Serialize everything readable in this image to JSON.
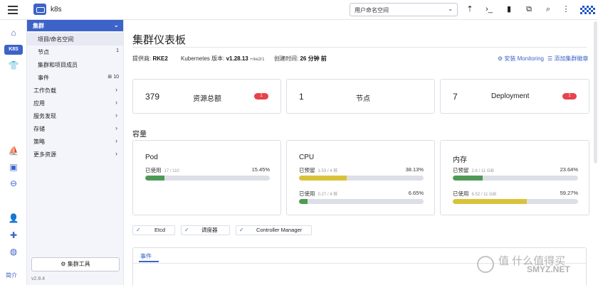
{
  "topbar": {
    "cluster_name": "k8s",
    "namespace_select": "用户命名空间",
    "icons": [
      "hamburger-icon",
      "cluster-logo-icon",
      "upload-icon",
      "terminal-icon",
      "file-icon",
      "copy-icon",
      "search-icon",
      "more-icon"
    ]
  },
  "rail": {
    "k8s_label": "K8S",
    "bottom_label": "简介",
    "icons": [
      "home-icon",
      "shirt-icon",
      "boat-icon",
      "folder-icon",
      "network-icon",
      "user-icon",
      "puzzle-icon",
      "globe-icon"
    ]
  },
  "sidenav": {
    "group": "集群",
    "sub_items": [
      {
        "label": "项目/命名空间",
        "count": ""
      },
      {
        "label": "节点",
        "count": "1"
      },
      {
        "label": "集群和项目成员",
        "count": ""
      },
      {
        "label": "事件",
        "count": "10"
      }
    ],
    "top_items": [
      "工作负载",
      "应用",
      "服务发现",
      "存储",
      "策略",
      "更多资源"
    ],
    "tools_button": "集群工具",
    "version": "v2.8.4"
  },
  "main": {
    "title": "集群仪表板",
    "provider_label": "提供商:",
    "provider_value": "RKE2",
    "k8s_label": "Kubernetes 版本:",
    "k8s_value": "v1.28.13",
    "k8s_suffix": "+rke2r1",
    "created_label": "创建时间:",
    "created_value": "26 分钟 前",
    "install_monitoring": "安装 Monitoring",
    "add_dashboard": "添加集群徽章",
    "counts": [
      {
        "value": "379",
        "label": "资源总额",
        "badge": "1"
      },
      {
        "value": "1",
        "label": "节点",
        "badge": ""
      },
      {
        "value": "7",
        "label": "Deployment",
        "badge": "1"
      }
    ],
    "capacity_label": "容量",
    "capacity": {
      "pod": {
        "title": "Pod",
        "used_label": "已使用",
        "used_sub": "17 / 110",
        "used_pct": "15.45%",
        "used_frac": 0.1545
      },
      "cpu": {
        "title": "CPU",
        "reserved_label": "已预留",
        "reserved_sub": "1.53 / 4 核",
        "reserved_pct": "38.13%",
        "reserved_frac": 0.3813,
        "used_label": "已使用",
        "used_sub": "0.27 / 4 核",
        "used_pct": "6.65%",
        "used_frac": 0.0665
      },
      "memory": {
        "title": "内存",
        "reserved_label": "已预留",
        "reserved_sub": "2.6 / 11 GiB",
        "reserved_pct": "23.64%",
        "reserved_frac": 0.2364,
        "used_label": "已使用",
        "used_sub": "6.52 / 11 GiB",
        "used_pct": "59.27%",
        "used_frac": 0.5927
      }
    },
    "services": [
      "Etcd",
      "调度器",
      "Controller Manager"
    ],
    "events_tab": "事件"
  },
  "colors": {
    "accent": "#3d63c8",
    "badge_red": "#e8424a",
    "bar_green": "#4e9a55",
    "bar_yellow": "#d9c23a",
    "bar_track": "#dcdfe6"
  },
  "watermark": {
    "cn": "值 什么值得买",
    "en": "SMYZ.NET"
  }
}
